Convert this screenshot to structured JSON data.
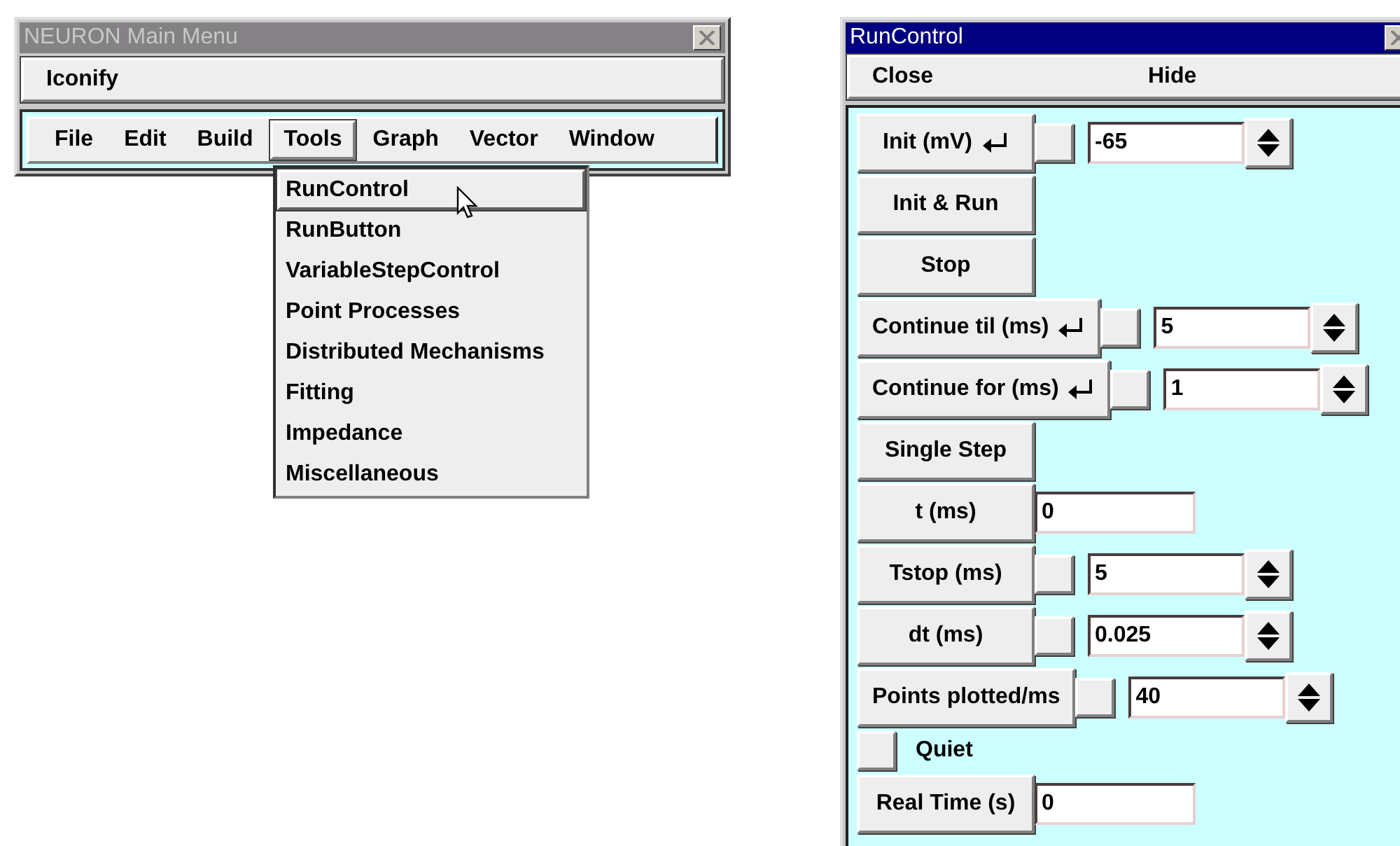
{
  "main_window": {
    "title": "NEURON Main Menu",
    "iconify": "Iconify",
    "menu": [
      {
        "label": "File",
        "selected": false
      },
      {
        "label": "Edit",
        "selected": false
      },
      {
        "label": "Build",
        "selected": false
      },
      {
        "label": "Tools",
        "selected": true
      },
      {
        "label": "Graph",
        "selected": false
      },
      {
        "label": "Vector",
        "selected": false
      },
      {
        "label": "Window",
        "selected": false
      }
    ],
    "dropdown": [
      {
        "label": "RunControl",
        "selected": true
      },
      {
        "label": "RunButton",
        "selected": false
      },
      {
        "label": "VariableStepControl",
        "selected": false
      },
      {
        "label": "Point Processes",
        "selected": false
      },
      {
        "label": "Distributed Mechanisms",
        "selected": false
      },
      {
        "label": "Fitting",
        "selected": false
      },
      {
        "label": "Impedance",
        "selected": false
      },
      {
        "label": "Miscellaneous",
        "selected": false
      }
    ]
  },
  "run_control": {
    "title": "RunControl",
    "bar": [
      "Close",
      "Hide"
    ],
    "rows": [
      {
        "kind": "field",
        "label": "Init (mV)",
        "enter": true,
        "checked": false,
        "value": "-65"
      },
      {
        "kind": "button",
        "label": "Init & Run"
      },
      {
        "kind": "button",
        "label": "Stop"
      },
      {
        "kind": "field",
        "label": "Continue til (ms)",
        "enter": true,
        "checked": false,
        "value": "5"
      },
      {
        "kind": "field",
        "label": "Continue for (ms)",
        "enter": true,
        "checked": false,
        "value": "1"
      },
      {
        "kind": "button",
        "label": "Single Step"
      },
      {
        "kind": "readout",
        "label": "t (ms)",
        "value": "0"
      },
      {
        "kind": "field",
        "label": "Tstop (ms)",
        "enter": false,
        "checked": false,
        "value": "5"
      },
      {
        "kind": "field",
        "label": "dt (ms)",
        "enter": false,
        "checked": false,
        "value": "0.025"
      },
      {
        "kind": "field",
        "label": "Points plotted/ms",
        "enter": false,
        "checked": false,
        "value": "40"
      },
      {
        "kind": "checkbox",
        "label": "Quiet",
        "checked": false
      },
      {
        "kind": "readout",
        "label": "Real Time (s)",
        "value": "0"
      }
    ]
  }
}
